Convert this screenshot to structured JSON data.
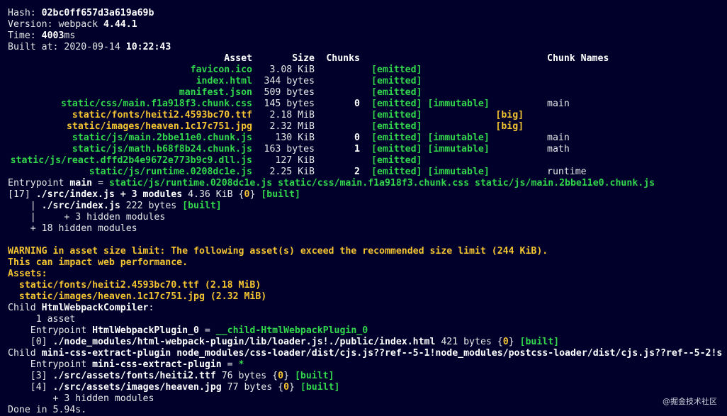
{
  "header": {
    "hash_label": "Hash: ",
    "hash": "02bc0ff657d3a619a69b",
    "version_label": "Version: webpack ",
    "version": "4.44.1",
    "time_label": "Time: ",
    "time": "4003",
    "time_unit": "ms",
    "built_label": "Built at: ",
    "built_date": "2020-09-14 ",
    "built_time": "10:22:43"
  },
  "asset_table": {
    "columns": [
      "Asset",
      "Size",
      "Chunks",
      "",
      "Chunk Names"
    ],
    "rows": [
      {
        "asset": "favicon.ico",
        "size": "3.08 KiB",
        "chunks": "",
        "emitted": "[emitted]",
        "flag": "",
        "names": "",
        "warn": false
      },
      {
        "asset": "index.html",
        "size": "344 bytes",
        "chunks": "",
        "emitted": "[emitted]",
        "flag": "",
        "names": "",
        "warn": false
      },
      {
        "asset": "manifest.json",
        "size": "509 bytes",
        "chunks": "",
        "emitted": "[emitted]",
        "flag": "",
        "names": "",
        "warn": false
      },
      {
        "asset": "static/css/main.f1a918f3.chunk.css",
        "size": "145 bytes",
        "chunks": "0",
        "emitted": "[emitted]",
        "flag": "[immutable]",
        "names": "main",
        "warn": false
      },
      {
        "asset": "static/fonts/heiti2.4593bc70.ttf",
        "size": "2.18 MiB",
        "chunks": "",
        "emitted": "[emitted]",
        "flag": "[big]",
        "names": "",
        "warn": true
      },
      {
        "asset": "static/images/heaven.1c17c751.jpg",
        "size": "2.32 MiB",
        "chunks": "",
        "emitted": "[emitted]",
        "flag": "[big]",
        "names": "",
        "warn": true
      },
      {
        "asset": "static/js/main.2bbe11e0.chunk.js",
        "size": "130 KiB",
        "chunks": "0",
        "emitted": "[emitted]",
        "flag": "[immutable]",
        "names": "main",
        "warn": false
      },
      {
        "asset": "static/js/math.b68f8b24.chunk.js",
        "size": "163 bytes",
        "chunks": "1",
        "emitted": "[emitted]",
        "flag": "[immutable]",
        "names": "math",
        "warn": false
      },
      {
        "asset": "static/js/react.dffd2b4e9672e773b9c9.dll.js",
        "size": "127 KiB",
        "chunks": "",
        "emitted": "[emitted]",
        "flag": "",
        "names": "",
        "warn": false
      },
      {
        "asset": "static/js/runtime.0208dc1e.js",
        "size": "2.25 KiB",
        "chunks": "2",
        "emitted": "[emitted]",
        "flag": "[immutable]",
        "names": "runtime",
        "warn": false
      }
    ]
  },
  "entrypoint": {
    "label": "Entrypoint ",
    "name": "main",
    "eq": " = ",
    "files": "static/js/runtime.0208dc1e.js static/css/main.f1a918f3.chunk.css static/js/main.2bbe11e0.chunk.js"
  },
  "modules": {
    "l1_id": "[17] ",
    "l1_path": "./src/index.js + 3 modules",
    "l1_size": " 4.36 KiB {",
    "l1_chunk": "0",
    "l1_close": "} ",
    "l1_status": "[built]",
    "l2_prefix": "    | ",
    "l2_path": "./src/index.js",
    "l2_size": " 222 bytes ",
    "l2_status": "[built]",
    "l3": "    |     + 3 hidden modules",
    "l4": "    + 18 hidden modules"
  },
  "warning": {
    "line1": "WARNING in asset size limit: The following asset(s) exceed the recommended size limit (244 KiB).",
    "line2": "This can impact web performance.",
    "line3": "Assets:",
    "a1": "  static/fonts/heiti2.4593bc70.ttf (2.18 MiB)",
    "a2": "  static/images/heaven.1c17c751.jpg (2.32 MiB)"
  },
  "child1": {
    "label": "Child ",
    "name": "HtmlWebpackCompiler",
    "colon": ":",
    "asset_line": "     1 asset",
    "entry_label": "    Entrypoint ",
    "entry_name": "HtmlWebpackPlugin_0",
    "entry_eq": " = ",
    "entry_file": "__child-HtmlWebpackPlugin_0",
    "mod_id": "    [0] ",
    "mod_path": "./node_modules/html-webpack-plugin/lib/loader.js!./public/index.html",
    "mod_size": " 421 bytes {",
    "mod_chunk": "0",
    "mod_close": "} ",
    "mod_status": "[built]"
  },
  "child2": {
    "label": "Child ",
    "name": "mini-css-extract-plugin node_modules/css-loader/dist/cjs.js??ref--5-1!node_modules/postcss-loader/dist/cjs.js??ref--5-2!s",
    "entry_label": "    Entrypoint ",
    "entry_name": "mini-css-extract-plugin",
    "entry_eq": " = ",
    "entry_file": "*",
    "m3_id": "    [3] ",
    "m3_path": "./src/assets/fonts/heiti2.ttf",
    "m3_size": " 76 bytes {",
    "m3_chunk": "0",
    "m3_close": "} ",
    "m3_status": "[built]",
    "m4_id": "    [4] ",
    "m4_path": "./src/assets/images/heaven.jpg",
    "m4_size": " 77 bytes {",
    "m4_chunk": "0",
    "m4_close": "} ",
    "m4_status": "[built]",
    "hidden": "        + 3 hidden modules"
  },
  "done": "Done in 5.94s.",
  "watermark": "@掘金技术社区",
  "colors": {
    "green": "#32d74b",
    "yellow": "#f4c431",
    "background": "#00002b",
    "text": "#e8e8e8"
  }
}
